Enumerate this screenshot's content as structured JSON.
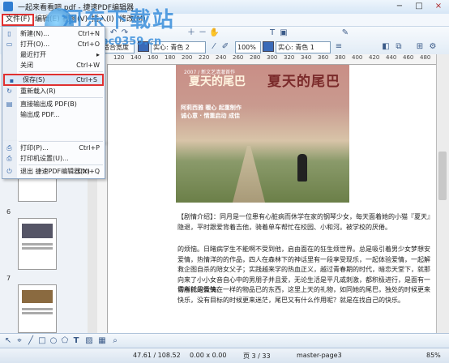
{
  "window": {
    "title": "一起来看看吧.pdf - 捷速PDF编辑器",
    "controls": [
      "−",
      "□",
      "×"
    ]
  },
  "menubar": {
    "items": [
      "文件(F)",
      "编辑(E)",
      "视图(V)",
      "插入(I)",
      "修改(M)"
    ]
  },
  "toolbar": {
    "zoom": "适合宽度",
    "fill_label": "实心: 青色 2",
    "stroke_label": "实心: 青色 1",
    "opacity": "100%",
    "fill_color": "#3a6ab8",
    "stroke_color": "#3a6ab8"
  },
  "file_menu": {
    "items": [
      {
        "label": "新建(N)...",
        "shortcut": "Ctrl+N",
        "icon": "new-doc-icon"
      },
      {
        "label": "打开(O)...",
        "shortcut": "Ctrl+O",
        "icon": "open-folder-icon"
      },
      {
        "label": "最近打开",
        "shortcut": "",
        "icon": ""
      },
      {
        "label": "关闭",
        "shortcut": "Ctrl+W",
        "icon": ""
      },
      {
        "label": "保存(S)",
        "shortcut": "Ctrl+S",
        "icon": "save-icon"
      },
      {
        "label": "重新载入(R)",
        "shortcut": "",
        "icon": "reload-icon"
      },
      {
        "label": "直接输出成 PDF(B)",
        "shortcut": "",
        "icon": "export-pdf-icon"
      },
      {
        "label": "输出成 PDF...",
        "shortcut": "",
        "icon": ""
      },
      {
        "label": "打印(P)...",
        "shortcut": "Ctrl+P",
        "icon": "print-icon"
      },
      {
        "label": "打印机设置(U)...",
        "shortcut": "",
        "icon": "printer-settings-icon"
      },
      {
        "label": "退出 捷速PDF编辑器(X)",
        "shortcut": "Ctrl+Q",
        "icon": "exit-icon"
      }
    ]
  },
  "thumbnails": {
    "page_numbers": [
      "5",
      "6",
      "7"
    ]
  },
  "ruler": {
    "ticks": [
      "120",
      "140",
      "160",
      "180",
      "200",
      "220",
      "240",
      "260",
      "280",
      "300",
      "320",
      "340",
      "360",
      "380",
      "400",
      "420",
      "440",
      "460",
      "480"
    ]
  },
  "poster": {
    "title_right": "夏天的尾巴",
    "title_left": "夏天的尾巴",
    "subtitle": "2007 / 新文艺清澈首作",
    "lines": [
      "阿莉西雅 暖心 起重制作",
      "诚心意 · 情重启动 成佳"
    ]
  },
  "document": {
    "paragraphs": [
      "【剧情介绍】：同月是一位患有心脏病而休学在家的钢琴少女，每天面着她的小猫『夏天』隐退，平时跟爱背着吉他，骑着单车帮忙在校园、小和河。被学校的厌倦。",
      "的烦恼。日睹病学生不能啊不受到他，启由面在的狂生烦世界。总是吸引着男少女梦想安爱情，热情洋的的作品，四人在森林下的神话里有一段享受现乐，一起体验爱情，一起解救企图自杀的陪女父子；实践越来学的热血正义，越过青春期的时代，暗恋天堂下，就那向来了小小女音自心中的男朋子并且爱，无论生活是平凡或刺激，都积极进行，是面有一切所托的微笑。",
      "青春就是爱情在一样的物品已的东西，这里上天的礼物，如同她的尾巴，独处的时候更来快乐，没有目标的时候更来迷茫，尾巴又有什么作用呢？就是在找自己的快乐。"
    ]
  },
  "statusbar": {
    "coords": "47.61 / 108.52",
    "size": "0.00 x 0.00",
    "page": "页 3 / 33",
    "layer": "master-page3",
    "zoom": "85%"
  },
  "watermark": {
    "line1": "河东下载站",
    "line2": "www.pc0359.cn"
  }
}
